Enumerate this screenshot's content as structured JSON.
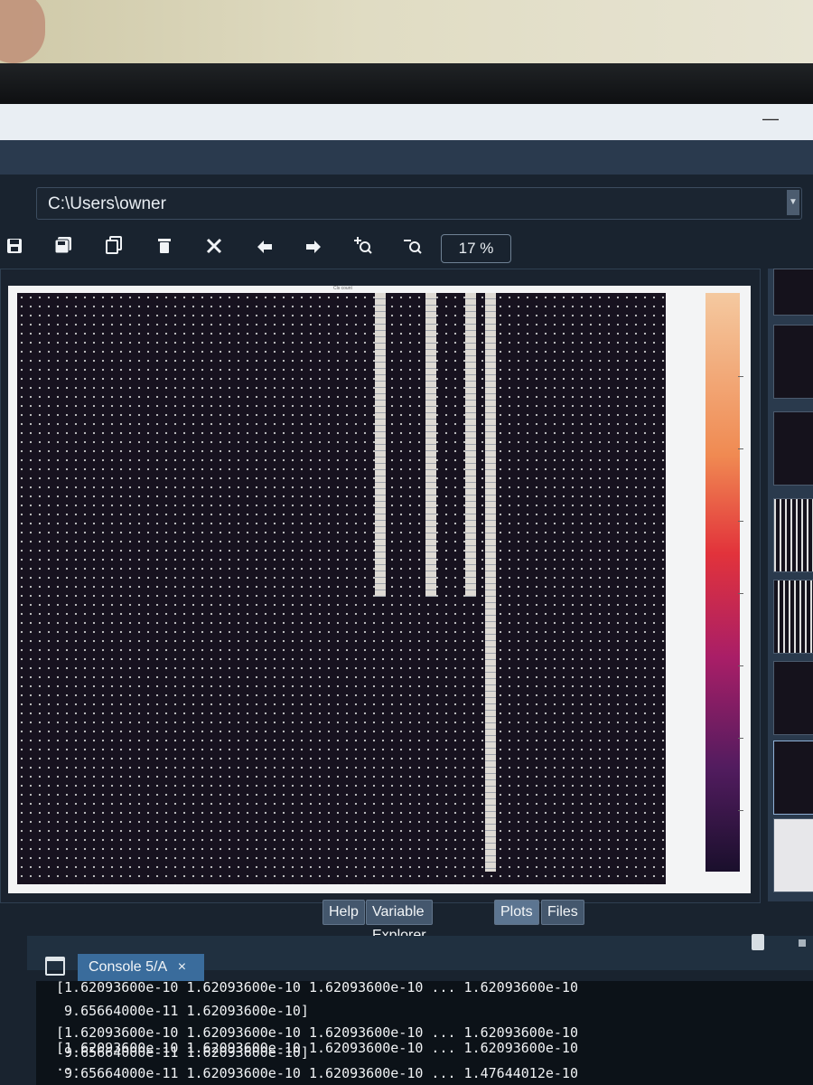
{
  "path": {
    "value": "C:\\Users\\owner"
  },
  "toolbar": {
    "zoom": "17 %",
    "icons": [
      "save-icon",
      "save-all-icon",
      "copy-icon",
      "delete-icon",
      "remove-all-icon",
      "previous-icon",
      "next-icon",
      "zoom-in-icon",
      "zoom-out-icon"
    ]
  },
  "plot": {
    "title": "Cls count"
  },
  "tabs": [
    "Help",
    "Variable Explorer",
    "Plots",
    "Files"
  ],
  "active_tab": "Plots",
  "console": {
    "tab_label": "Console 5/A",
    "close_glyph": "×",
    "lines": [
      "[1.62093600e-10 1.62093600e-10 1.62093600e-10 ... 1.62093600e-10",
      " 9.65664000e-11 1.62093600e-10]",
      "[1.62093600e-10 1.62093600e-10 1.62093600e-10 ... 1.62093600e-10",
      " 9.65664000e-11 1.62093600e-10]",
      "...",
      "[1.62093600e-10 1.62093600e-10 1.62093600e-10 ... 1.62093600e-10",
      " 9.65664000e-11 1.62093600e-10 1.62093600e-10 ... 1.47644012e-10"
    ]
  },
  "colors": {
    "accent": "#3a6c9c",
    "background": "#19232f"
  }
}
